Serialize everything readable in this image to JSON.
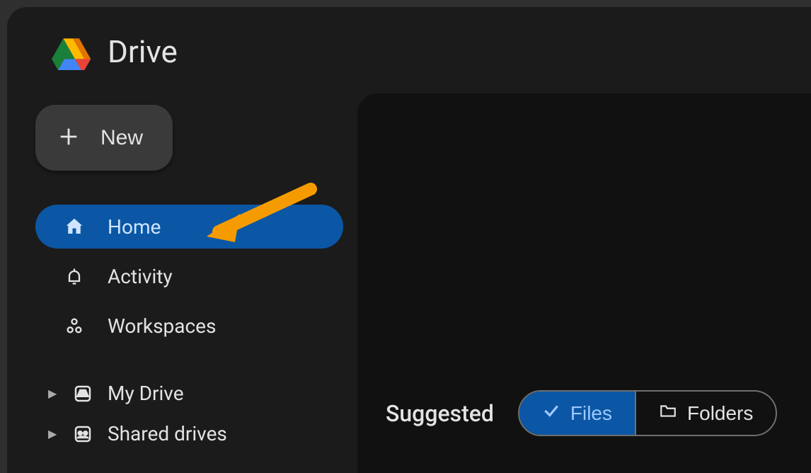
{
  "app": {
    "title": "Drive"
  },
  "sidebar": {
    "new_label": "New",
    "nav": [
      {
        "label": "Home",
        "active": true
      },
      {
        "label": "Activity",
        "active": false
      },
      {
        "label": "Workspaces",
        "active": false
      }
    ],
    "tree": [
      {
        "label": "My Drive"
      },
      {
        "label": "Shared drives"
      }
    ]
  },
  "main": {
    "suggested_label": "Suggested",
    "chips": {
      "files": "Files",
      "folders": "Folders",
      "selected": "files"
    }
  }
}
